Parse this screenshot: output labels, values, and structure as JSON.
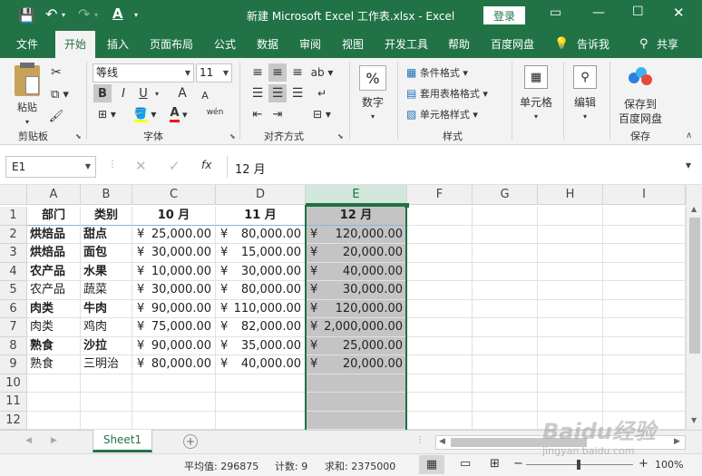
{
  "titlebar": {
    "title": "新建 Microsoft Excel 工作表.xlsx  -  Excel",
    "login_label": "登录"
  },
  "tabs": [
    {
      "label": "文件"
    },
    {
      "label": "开始"
    },
    {
      "label": "插入"
    },
    {
      "label": "页面布局"
    },
    {
      "label": "公式"
    },
    {
      "label": "数据"
    },
    {
      "label": "审阅"
    },
    {
      "label": "视图"
    },
    {
      "label": "开发工具"
    },
    {
      "label": "帮助"
    },
    {
      "label": "百度网盘"
    },
    {
      "label": "告诉我"
    },
    {
      "label": "共享"
    }
  ],
  "ribbon": {
    "paste": "粘贴",
    "clipboard": "剪贴板",
    "font_name": "等线",
    "font_size": "11",
    "font_group": "字体",
    "align_group": "对齐方式",
    "number_label": "数字",
    "number_icon": "%",
    "cond_format": "条件格式",
    "table_format": "套用表格格式",
    "cell_style": "单元格样式",
    "style_group": "样式",
    "cells_label": "单元格",
    "edit_label": "编辑",
    "save_line1": "保存到",
    "save_line2": "百度网盘",
    "save_group": "保存",
    "bold": "B",
    "italic": "I",
    "underline": "U",
    "grow": "A",
    "shrink": "A",
    "fontcolor": "A",
    "wen": "wén"
  },
  "formula": {
    "namebox": "E1",
    "fx": "fx",
    "content": "12 月"
  },
  "columns": [
    "A",
    "B",
    "C",
    "D",
    "E",
    "F",
    "G",
    "H",
    "I"
  ],
  "rows": [
    "1",
    "2",
    "3",
    "4",
    "5",
    "6",
    "7",
    "8",
    "9",
    "10",
    "11",
    "12"
  ],
  "header_row": [
    "部门",
    "类别",
    "10 月",
    "11 月",
    "12 月"
  ],
  "data_rows": [
    [
      "烘焙品",
      "甜点",
      "25,000.00",
      "80,000.00",
      "120,000.00"
    ],
    [
      "烘焙品",
      "面包",
      "30,000.00",
      "15,000.00",
      "20,000.00"
    ],
    [
      "农产品",
      "水果",
      "10,000.00",
      "30,000.00",
      "40,000.00"
    ],
    [
      "农产品",
      "蔬菜",
      "30,000.00",
      "80,000.00",
      "30,000.00"
    ],
    [
      "肉类",
      "牛肉",
      "90,000.00",
      "110,000.00",
      "120,000.00"
    ],
    [
      "肉类",
      "鸡肉",
      "75,000.00",
      "82,000.00",
      "2,000,000.00"
    ],
    [
      "熟食",
      "沙拉",
      "90,000.00",
      "35,000.00",
      "25,000.00"
    ],
    [
      "熟食",
      "三明治",
      "80,000.00",
      "40,000.00",
      "20,000.00"
    ]
  ],
  "currency": "¥",
  "sheet": {
    "name": "Sheet1"
  },
  "status": {
    "average": "平均值: 296875",
    "count": "计数: 9",
    "sum": "求和: 2375000",
    "zoom": "100%"
  },
  "watermark": {
    "text": "Baidu经验",
    "sub": "jingyan.baidu.com"
  },
  "colors": {
    "excel_green": "#217346",
    "selection_gray": "#c4c4c4",
    "selection_border": "#1e7145"
  }
}
